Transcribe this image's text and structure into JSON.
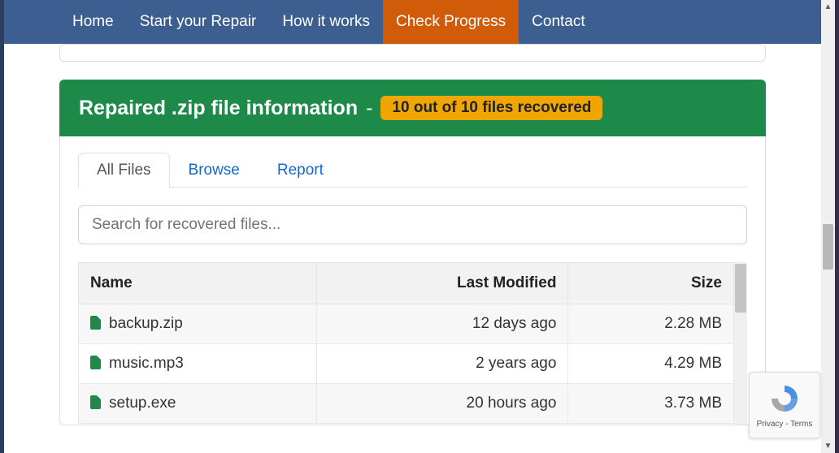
{
  "nav": {
    "items": [
      {
        "label": "Home",
        "active": false
      },
      {
        "label": "Start your Repair",
        "active": false
      },
      {
        "label": "How it works",
        "active": false
      },
      {
        "label": "Check Progress",
        "active": true
      },
      {
        "label": "Contact",
        "active": false
      }
    ]
  },
  "panel": {
    "title": "Repaired .zip file information",
    "dash": "-",
    "badge": "10 out of 10 files recovered"
  },
  "tabs": [
    {
      "label": "All Files",
      "active": true
    },
    {
      "label": "Browse",
      "active": false
    },
    {
      "label": "Report",
      "active": false
    }
  ],
  "search": {
    "placeholder": "Search for recovered files..."
  },
  "table": {
    "columns": [
      "Name",
      "Last Modified",
      "Size"
    ],
    "rows": [
      {
        "name": "backup.zip",
        "modified": "12 days ago",
        "size": "2.28 MB"
      },
      {
        "name": "music.mp3",
        "modified": "2 years ago",
        "size": "4.29 MB"
      },
      {
        "name": "setup.exe",
        "modified": "20 hours ago",
        "size": "3.73 MB"
      }
    ]
  },
  "recaptcha": {
    "privacy": "Privacy",
    "sep": " - ",
    "terms": "Terms"
  }
}
